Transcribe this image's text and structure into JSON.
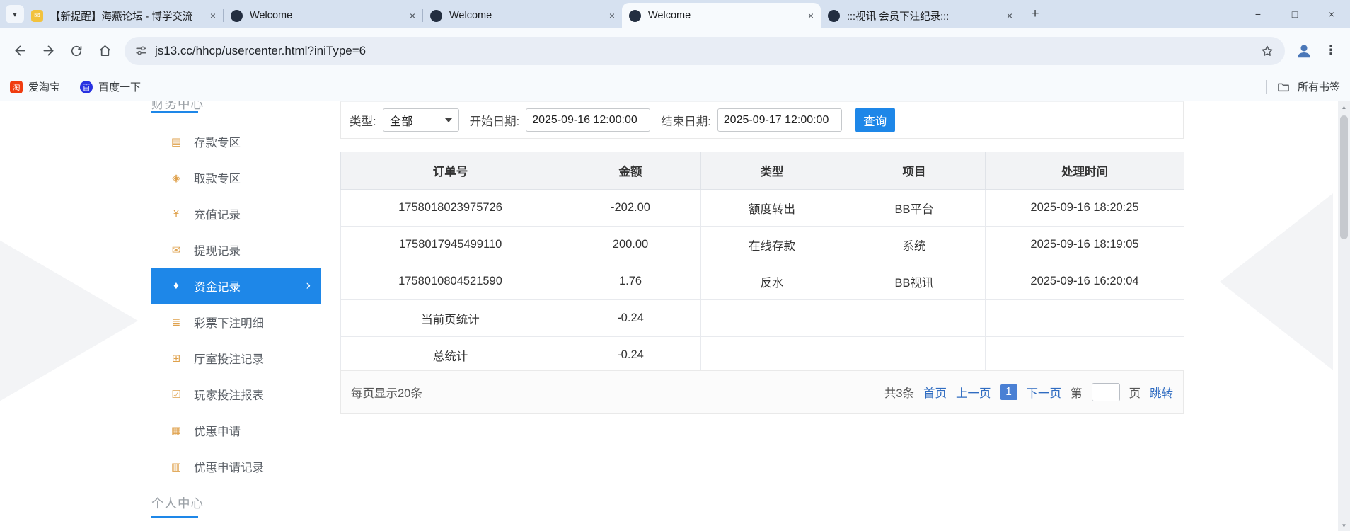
{
  "browser": {
    "tabs": [
      {
        "title": "【新提醒】海燕论坛 - 博学交流",
        "favicon": "yellow",
        "favicon_glyph": "✉",
        "active": false
      },
      {
        "title": "Welcome",
        "favicon": "dark",
        "favicon_glyph": "",
        "active": false
      },
      {
        "title": "Welcome",
        "favicon": "dark",
        "favicon_glyph": "",
        "active": false
      },
      {
        "title": "Welcome",
        "favicon": "dark",
        "favicon_glyph": "",
        "active": true
      },
      {
        "title": ":::视讯 会员下注纪录:::",
        "favicon": "dark",
        "favicon_glyph": "",
        "active": false
      }
    ],
    "url": "js13.cc/hhcp/usercenter.html?iniType=6",
    "bookmarks": [
      {
        "label": "爱淘宝",
        "glyph": "淘",
        "color": "#f03c10"
      },
      {
        "label": "百度一下",
        "glyph": "百",
        "color": "#2932e1"
      }
    ],
    "all_bookmarks_label": "所有书签"
  },
  "icons": {
    "close": "×",
    "new_tab": "+",
    "minimize": "−",
    "maximize": "□",
    "window_close": "×",
    "menu": "⋮",
    "chevron_right": "›",
    "tab_search": "▾",
    "scroll_up": "▲",
    "scroll_down": "▼"
  },
  "sidebar": {
    "section_top": "财务中心",
    "section_bottom": "个人中心",
    "items": [
      {
        "label": "存款专区",
        "icon": "deposit-icon",
        "glyph": "▤",
        "active": false
      },
      {
        "label": "取款专区",
        "icon": "withdraw-icon",
        "glyph": "◈",
        "active": false
      },
      {
        "label": "充值记录",
        "icon": "recharge-record-icon",
        "glyph": "¥",
        "active": false
      },
      {
        "label": "提现记录",
        "icon": "withdrawal-record-icon",
        "glyph": "✉",
        "active": false
      },
      {
        "label": "资金记录",
        "icon": "funds-record-icon",
        "glyph": "♦",
        "active": true
      },
      {
        "label": "彩票下注明细",
        "icon": "lottery-bet-detail-icon",
        "glyph": "≣",
        "active": false
      },
      {
        "label": "厅室投注记录",
        "icon": "room-bet-record-icon",
        "glyph": "⊞",
        "active": false
      },
      {
        "label": "玩家投注报表",
        "icon": "player-bet-report-icon",
        "glyph": "☑",
        "active": false
      },
      {
        "label": "优惠申请",
        "icon": "promo-apply-icon",
        "glyph": "▦",
        "active": false
      },
      {
        "label": "优惠申请记录",
        "icon": "promo-apply-record-icon",
        "glyph": "▥",
        "active": false
      }
    ]
  },
  "filters": {
    "type_label": "类型:",
    "type_value": "全部",
    "start_label": "开始日期:",
    "start_value": "2025-09-16 12:00:00",
    "end_label": "结束日期:",
    "end_value": "2025-09-17 12:00:00",
    "search_button": "查询"
  },
  "table": {
    "headers": [
      "订单号",
      "金额",
      "类型",
      "项目",
      "处理时间"
    ],
    "rows": [
      [
        "1758018023975726",
        "-202.00",
        "额度转出",
        "BB平台",
        "2025-09-16 18:20:25"
      ],
      [
        "1758017945499110",
        "200.00",
        "在线存款",
        "系统",
        "2025-09-16 18:19:05"
      ],
      [
        "1758010804521590",
        "1.76",
        "反水",
        "BB视讯",
        "2025-09-16 16:20:04"
      ],
      [
        "当前页统计",
        "-0.24",
        "",
        "",
        ""
      ],
      [
        "总统计",
        "-0.24",
        "",
        "",
        ""
      ]
    ]
  },
  "pagination": {
    "page_size_text": "每页显示20条",
    "total_text": "共3条",
    "first": "首页",
    "prev": "上一页",
    "current": "1",
    "next": "下一页",
    "jump_prefix": "第",
    "jump_suffix": "页",
    "jump_button": "跳转",
    "jump_value": ""
  },
  "colors": {
    "accent_blue": "#1e87e8",
    "link_blue": "#2f6cc1",
    "sidebar_icon_orange": "#dfa14c",
    "tabstrip_bg": "#d6e1f0"
  }
}
